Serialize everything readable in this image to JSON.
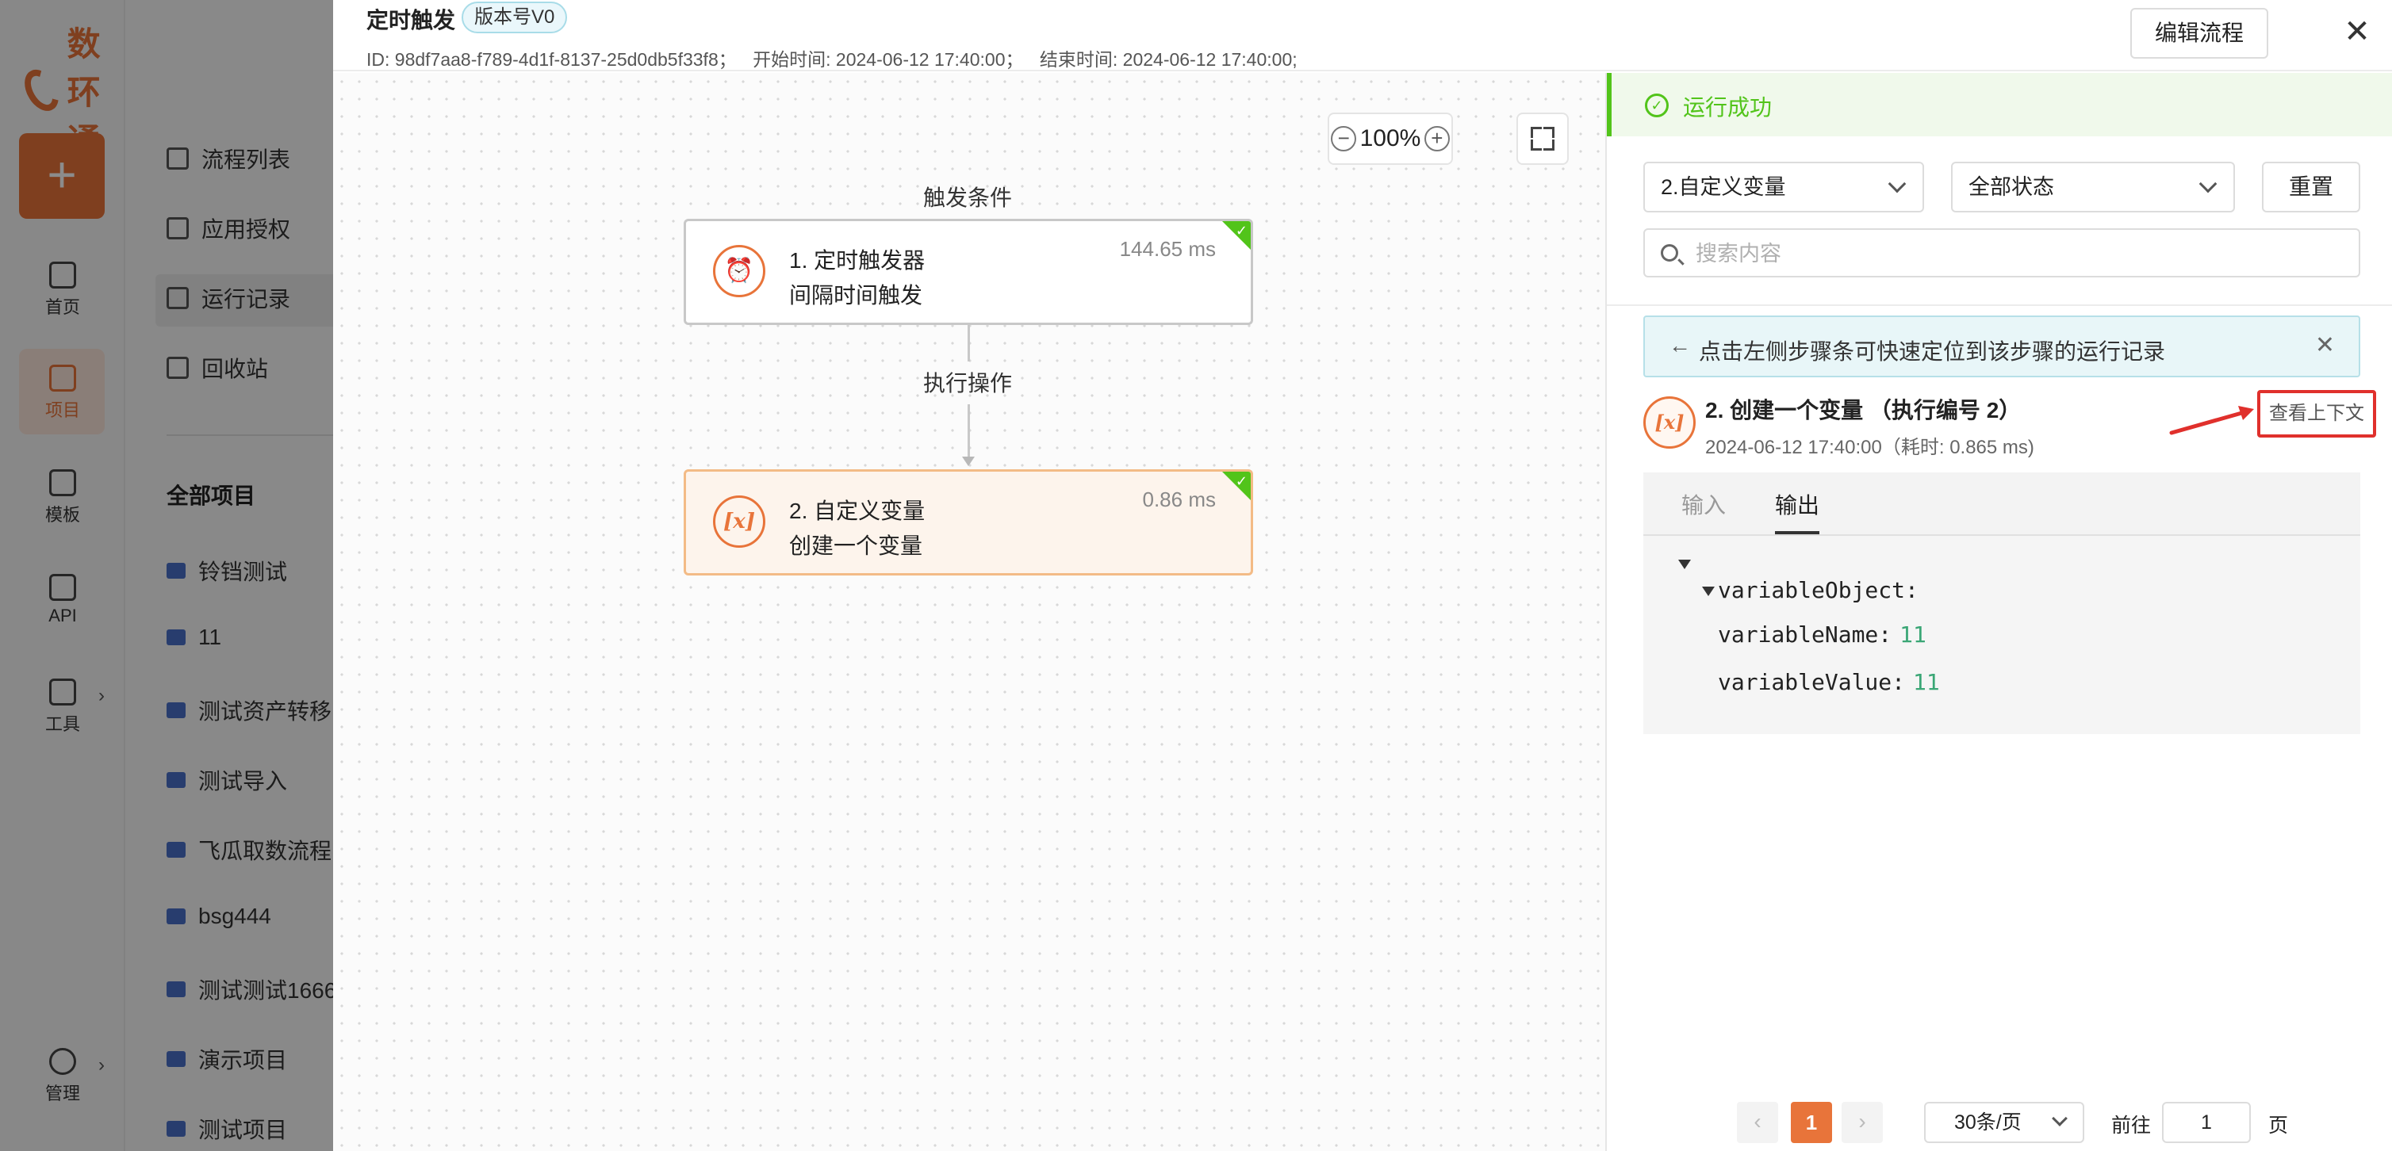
{
  "app": {
    "logo_text": "数环通",
    "brand_color": "#e8743a",
    "rail": [
      {
        "label": "首页",
        "icon": "monitor-icon"
      },
      {
        "label": "项目",
        "icon": "layers-icon"
      },
      {
        "label": "模板",
        "icon": "grid-icon"
      },
      {
        "label": "API",
        "icon": "api-icon"
      },
      {
        "label": "工具",
        "icon": "sliders-icon"
      },
      {
        "label": "管理",
        "icon": "gear-icon"
      }
    ],
    "subnav": [
      {
        "label": "流程列表",
        "icon": "stack-icon"
      },
      {
        "label": "应用授权",
        "icon": "apps-icon"
      },
      {
        "label": "运行记录",
        "icon": "clipboard-icon"
      },
      {
        "label": "回收站",
        "icon": "trash-icon"
      }
    ],
    "projects_heading": "全部项目",
    "projects": [
      "铃铛测试",
      "11",
      "测试资产转移",
      "测试导入",
      "飞瓜取数流程",
      "bsg444",
      "测试测试1666",
      "演示项目",
      "测试项目"
    ]
  },
  "drawer": {
    "title": "定时触发",
    "version_tag": "版本号V0",
    "meta": {
      "id": "ID: 98df7aa8-f789-4d1f-8137-25d0db5f33f8；",
      "start": "开始时间: 2024-06-12 17:40:00；",
      "end": "结束时间: 2024-06-12 17:40:00;"
    },
    "edit_button": "编辑流程",
    "close_icon": "close-icon"
  },
  "canvas": {
    "zoom_minus": "−",
    "zoom_level": "100%",
    "zoom_plus": "+",
    "trigger_label": "触发条件",
    "action_label": "执行操作",
    "nodes": [
      {
        "line1": "1. 定时触发器",
        "line2": "间隔时间触发",
        "time": "144.65 ms",
        "icon": "alarm-clock-icon",
        "icon_text": "⏰"
      },
      {
        "line1": "2. 自定义变量",
        "line2": "创建一个变量",
        "time": "0.86 ms",
        "icon": "variable-icon",
        "icon_text": "[x]"
      }
    ]
  },
  "panel": {
    "success_text": "运行成功",
    "success_color": "#52c41a",
    "step_select": "2.自定义变量",
    "status_select": "全部状态",
    "reset_button": "重置",
    "search_placeholder": "搜索内容",
    "tip_arrow": "←",
    "tip_text": "点击左侧步骤条可快速定位到该步骤的运行记录",
    "tip_close": "✕",
    "step": {
      "icon_text": "[x]",
      "title": "2. 创建一个变量 （执行编号 2）",
      "subtitle": "2024-06-12 17:40:00（耗时: 0.865 ms)",
      "context_button": "查看上下文"
    },
    "tabs": {
      "input": "输入",
      "output": "输出"
    },
    "output": {
      "object_key": "variableObject:",
      "rows": [
        {
          "key": "variableName:",
          "value": "11"
        },
        {
          "key": "variableValue:",
          "value": "11"
        }
      ]
    },
    "pagination": {
      "prev": "‹",
      "current": "1",
      "next": "›",
      "page_size": "30条/页",
      "goto_label": "前往",
      "goto_value": "1",
      "page_suffix": "页"
    }
  }
}
